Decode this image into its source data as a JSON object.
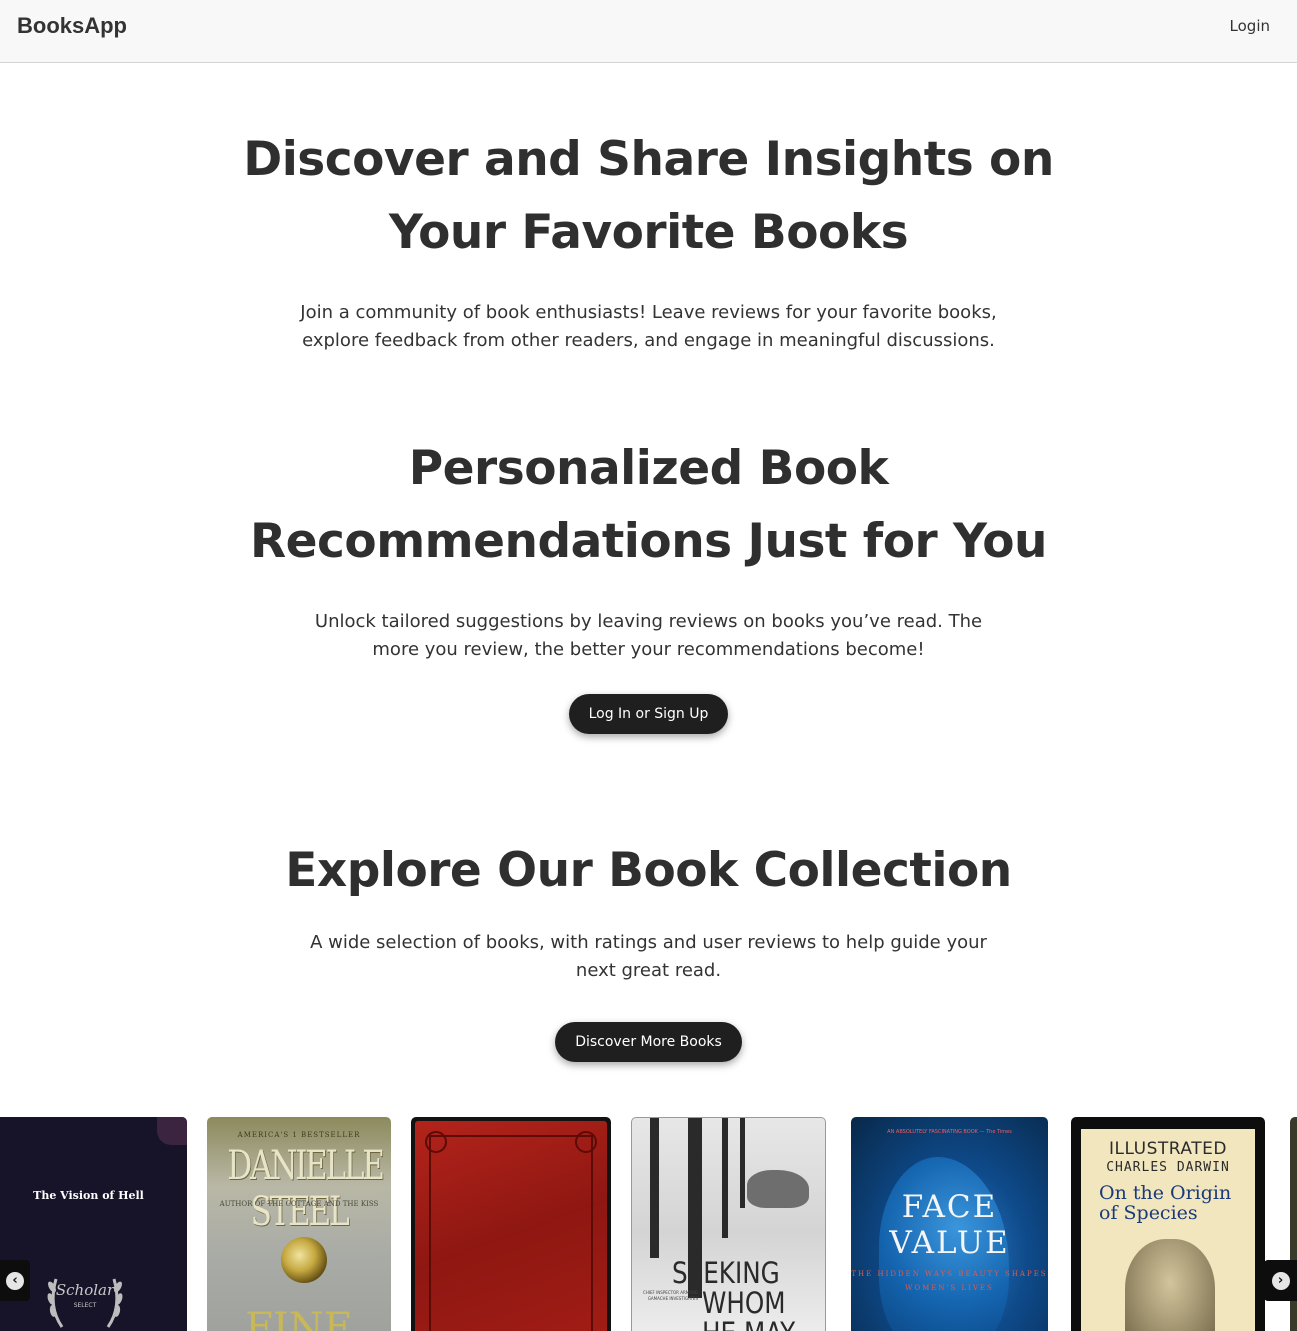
{
  "navbar": {
    "brand": "BooksApp",
    "login": "Login"
  },
  "hero": {
    "headline": "Discover and Share Insights on Your Favorite Books",
    "lead": "Join a community of book enthusiasts! Leave reviews for your favorite books, explore feedback from other readers, and engage in meaningful discussions."
  },
  "recommendations": {
    "headline": "Personalized Book Recommendations Just for You",
    "lead": "Unlock tailored suggestions by leaving reviews on books you’ve read. The more you review, the better your recommendations become!",
    "button": "Log In or Sign Up"
  },
  "collection": {
    "headline": "Explore Our Book Collection",
    "lead": "A wide selection of books, with ratings and user reviews to help guide your next great read.",
    "button": "Discover More Books"
  },
  "carousel": {
    "prev_icon": "chevron-left-circle-icon",
    "next_icon": "chevron-right-circle-icon",
    "prev_glyph": "‹",
    "next_glyph": "›",
    "books": [
      {
        "title_text": "The Vision of Hell",
        "seal_text_1": "Scholar",
        "seal_text_2": "SELECT"
      },
      {
        "top_text": "AMERICA'S 1 BESTSELLER",
        "author_text": "DANIELLE STEEL",
        "sub_text": "AUTHOR OF THE COTTAGE AND THE KISS",
        "title_text": "FINE"
      },
      {},
      {
        "title_text_1": "SEEKING",
        "title_text_2": "WHOM",
        "title_text_3": "HE MAY",
        "small_text": "CHIEF INSPECTOR ARMAND GAMACHE INVESTIGATES"
      },
      {
        "tag_text": "AN ABSOLUTELY FASCINATING BOOK — The Times",
        "title_text_1": "FACE",
        "title_text_2": "VALUE",
        "sub_text": "THE HIDDEN WAYS BEAUTY SHAPES WOMEN'S LIVES"
      },
      {
        "label_text": "ILLUSTRATED",
        "author_text": "CHARLES DARWIN",
        "title_text_1": "On the Origin",
        "title_text_2": "of Species"
      }
    ]
  }
}
